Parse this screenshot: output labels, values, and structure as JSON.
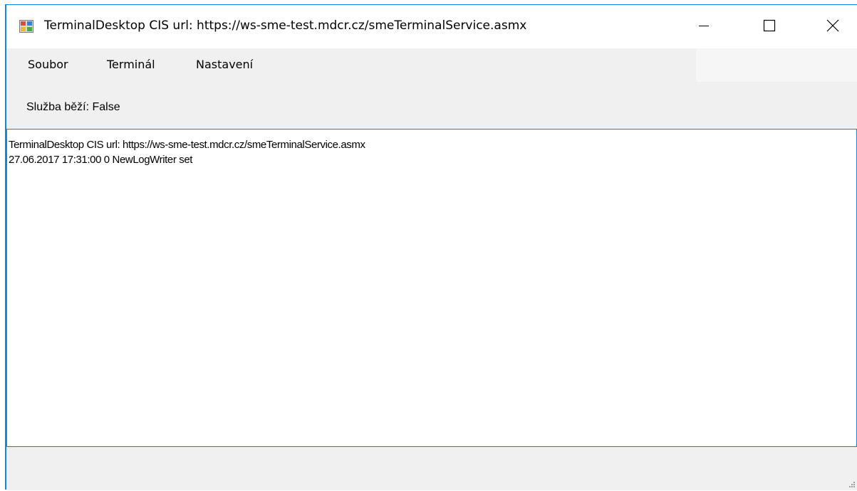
{
  "window": {
    "title": "TerminalDesktop CIS url: https://ws-sme-test.mdcr.cz/smeTerminalService.asmx"
  },
  "menu": {
    "items": [
      {
        "label": "Soubor"
      },
      {
        "label": "Terminál"
      },
      {
        "label": "Nastavení"
      }
    ]
  },
  "toolbar": {
    "status_text": "Služba běží: False"
  },
  "log": {
    "lines": [
      "TerminalDesktop CIS url: https://ws-sme-test.mdcr.cz/smeTerminalService.asmx",
      "27.06.2017 17:31:00 0 NewLogWriter set"
    ]
  },
  "icons": {
    "app": "app-window-icon",
    "minimize": "minimize-icon",
    "maximize": "maximize-icon",
    "close": "close-icon",
    "grip": "resize-grip-icon"
  },
  "colors": {
    "accent_border": "#1883d7",
    "chrome_background": "#f0f0f0"
  }
}
